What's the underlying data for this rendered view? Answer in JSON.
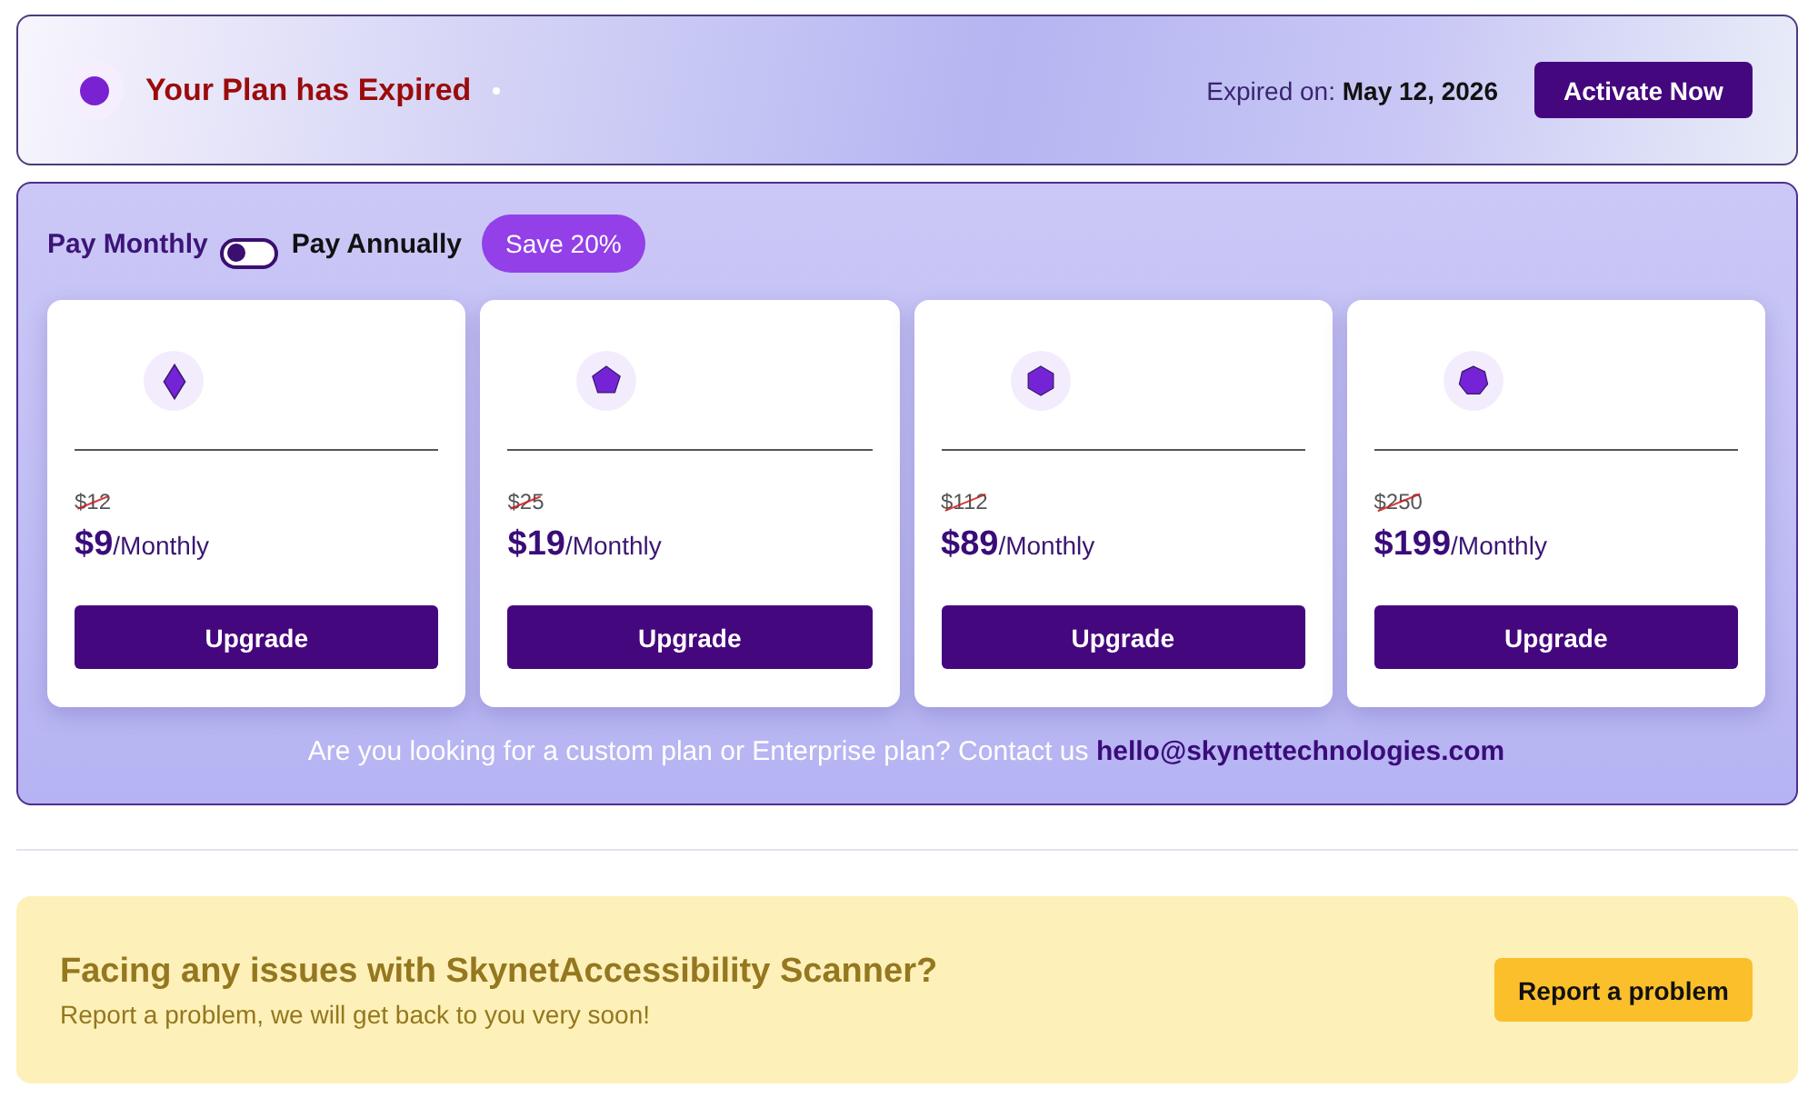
{
  "expired_banner": {
    "title": "Your Plan has Expired",
    "expired_label": "Expired on:",
    "expired_date": "May 12, 2026",
    "button": "Activate Now"
  },
  "billing": {
    "options": [
      {
        "label": "Pay Monthly",
        "selected": true
      },
      {
        "label": "Pay Annually",
        "selected": false
      }
    ],
    "toggle": {
      "on": false
    },
    "badge": "Save 20%"
  },
  "plans": [
    {
      "old_price": "$12",
      "price": "$9",
      "period": "/Monthly",
      "button": "Upgrade"
    },
    {
      "old_price": "$25",
      "price": "$19",
      "period": "/Monthly",
      "button": "Upgrade"
    },
    {
      "old_price": "$112",
      "price": "$89",
      "period": "/Monthly",
      "button": "Upgrade"
    },
    {
      "old_price": "$250",
      "price": "$199",
      "period": "/Monthly",
      "button": "Upgrade"
    }
  ],
  "contact": {
    "text": "Are you looking for a custom plan or Enterprise plan? Contact us",
    "email": "hello@skynettechnologies.com"
  },
  "support": {
    "title": "Facing any issues with SkynetAccessibility Scanner?",
    "subtitle": "Report a problem, we will get back to you very soon!",
    "button": "Report a problem"
  }
}
